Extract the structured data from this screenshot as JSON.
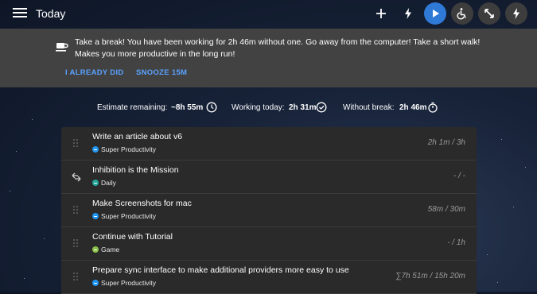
{
  "header": {
    "title": "Today",
    "icons": [
      "menu-icon",
      "add-icon",
      "bolt-icon",
      "play-icon",
      "accessibility-icon",
      "fullscreen-icon",
      "bolt-icon"
    ]
  },
  "banner": {
    "message": "Take a break! You have been working for 2h 46m without one. Go away from the computer! Take a short walk! Makes you more productive in the long run!",
    "already_did_label": "I ALREADY DID",
    "snooze_label": "SNOOZE 15M"
  },
  "stats": {
    "estimate_label": "Estimate remaining:",
    "estimate_value": "~8h 55m",
    "working_label": "Working today:",
    "working_value": "2h 31m",
    "break_label": "Without break:",
    "break_value": "2h 46m"
  },
  "tasks": [
    {
      "title": "Write an article about v6",
      "tag": "Super Productivity",
      "tag_color": "#2196f3",
      "time": "2h 1m / 3h",
      "repeat": false
    },
    {
      "title": "Inhibition is the Mission",
      "tag": "Daily",
      "tag_color": "#26a69a",
      "time": "- / -",
      "repeat": true
    },
    {
      "title": "Make Screenshots for mac",
      "tag": "Super Productivity",
      "tag_color": "#2196f3",
      "time": "58m / 30m",
      "repeat": false
    },
    {
      "title": "Continue with Tutorial",
      "tag": "Game",
      "tag_color": "#8bc34a",
      "time": "- / 1h",
      "repeat": false
    },
    {
      "title": "Prepare sync interface to make additional providers more easy to use",
      "tag": "Super Productivity",
      "tag_color": "#2196f3",
      "time": "∑7h 51m / 15h 20m",
      "repeat": false
    }
  ]
}
